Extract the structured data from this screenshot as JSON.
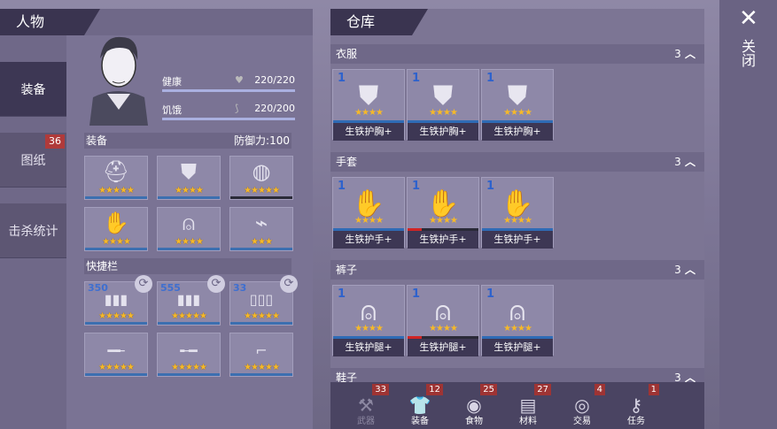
{
  "left": {
    "title": "人物",
    "tabs": [
      {
        "label": "装备",
        "badge": ""
      },
      {
        "label": "图纸",
        "badge": "36"
      },
      {
        "label": "击杀统计",
        "badge": ""
      }
    ],
    "stats": [
      {
        "label": "健康",
        "value": "220/220",
        "icon": "heart-icon",
        "level": 1.0
      },
      {
        "label": "饥饿",
        "value": "220/200",
        "icon": "stomach-icon",
        "level": 1.0
      }
    ],
    "equip_label": "装备",
    "defense_label": "防御力:",
    "defense_value": "100",
    "equip_slots": [
      {
        "icon": "helmet-icon",
        "stars": "★★★★★"
      },
      {
        "icon": "chest-armor-icon",
        "stars": "★★★★"
      },
      {
        "icon": "chainmail-icon",
        "stars": "★★★★★"
      },
      {
        "icon": "gloves-icon",
        "stars": "★★★★"
      },
      {
        "icon": "pants-icon",
        "stars": "★★★★"
      },
      {
        "icon": "boots-icon",
        "stars": "★★★"
      }
    ],
    "quickbar_label": "快捷栏",
    "quick_slots": [
      {
        "count": "350",
        "icon": "ammo-icon",
        "stars": "★★★★★"
      },
      {
        "count": "555",
        "icon": "ammo-icon",
        "stars": "★★★★★"
      },
      {
        "count": "33",
        "icon": "shells-icon",
        "stars": "★★★★★"
      },
      {
        "count": "",
        "icon": "rifle-icon",
        "stars": "★★★★★"
      },
      {
        "count": "",
        "icon": "shotgun-icon",
        "stars": "★★★★★"
      },
      {
        "count": "",
        "icon": "revolver-icon",
        "stars": "★★★★★"
      }
    ]
  },
  "right": {
    "title": "仓库",
    "categories": [
      {
        "name": "衣服",
        "count": "3",
        "items": [
          {
            "num": "1",
            "label": "生铁护胸+",
            "stars": "★★★★",
            "icon": "chest-armor-icon",
            "strip": "blue"
          },
          {
            "num": "1",
            "label": "生铁护胸+",
            "stars": "★★★★",
            "icon": "chest-armor-icon",
            "strip": "blue"
          },
          {
            "num": "1",
            "label": "生铁护胸+",
            "stars": "★★★★",
            "icon": "chest-armor-icon",
            "strip": "blue"
          }
        ]
      },
      {
        "name": "手套",
        "count": "3",
        "items": [
          {
            "num": "1",
            "label": "生铁护手+",
            "stars": "★★★★",
            "icon": "gloves-icon",
            "strip": "blue"
          },
          {
            "num": "1",
            "label": "生铁护手+",
            "stars": "★★★★",
            "icon": "gloves-icon",
            "strip": "red"
          },
          {
            "num": "1",
            "label": "生铁护手+",
            "stars": "★★★★",
            "icon": "gloves-icon",
            "strip": "blue"
          }
        ]
      },
      {
        "name": "裤子",
        "count": "3",
        "items": [
          {
            "num": "1",
            "label": "生铁护腿+",
            "stars": "★★★★",
            "icon": "pants-icon",
            "strip": "blue"
          },
          {
            "num": "1",
            "label": "生铁护腿+",
            "stars": "★★★★",
            "icon": "pants-icon",
            "strip": "red"
          },
          {
            "num": "1",
            "label": "生铁护腿+",
            "stars": "★★★★",
            "icon": "pants-icon",
            "strip": "blue"
          }
        ]
      },
      {
        "name": "鞋子",
        "count": "3",
        "items": []
      }
    ],
    "bottom_tabs": [
      {
        "label": "武器",
        "badge": "33",
        "icon": "axe-icon",
        "dim": true
      },
      {
        "label": "装备",
        "badge": "12",
        "icon": "shirt-icon",
        "dim": false
      },
      {
        "label": "食物",
        "badge": "25",
        "icon": "meat-icon",
        "dim": false
      },
      {
        "label": "材料",
        "badge": "27",
        "icon": "plank-icon",
        "dim": false
      },
      {
        "label": "交易",
        "badge": "4",
        "icon": "coin-icon",
        "dim": false
      },
      {
        "label": "任务",
        "badge": "1",
        "icon": "key-icon",
        "dim": false
      }
    ]
  },
  "close": {
    "label": "关闭",
    "icon": "close-x-icon"
  },
  "colors": {
    "star": "#f6b928",
    "badge": "#b03a3a",
    "rarity_blue": "#2f6bb5",
    "rarity_red": "#d02424"
  }
}
